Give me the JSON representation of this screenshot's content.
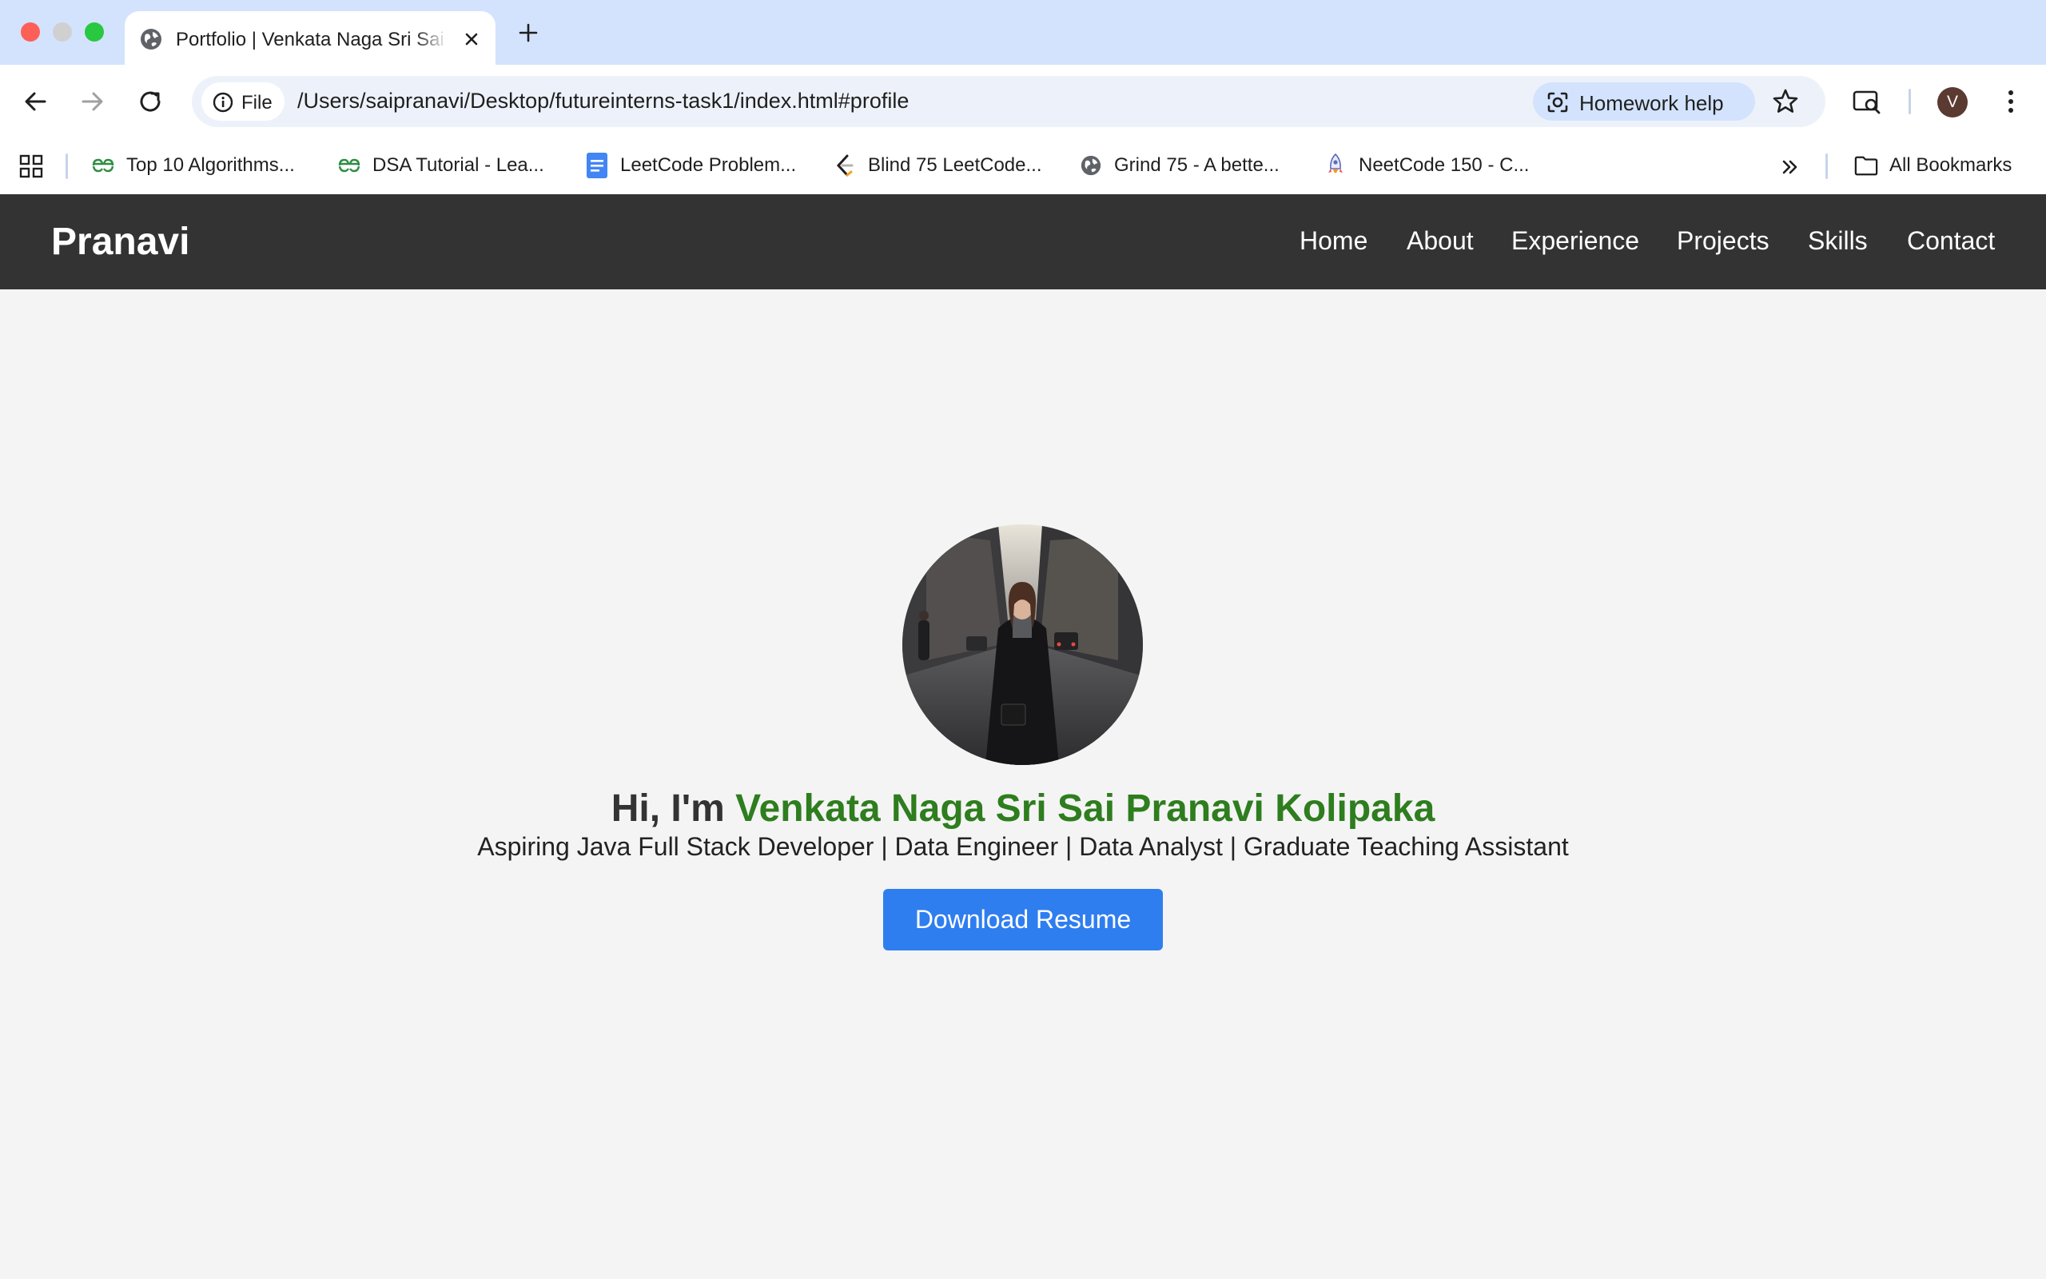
{
  "browser": {
    "tab": {
      "title": "Portfolio | Venkata Naga Sri Sai Pranavi Kolipaka"
    },
    "address_bar": {
      "scheme_chip": "File",
      "url": "/Users/saipranavi/Desktop/futureinterns-task1/index.html#profile"
    },
    "homework_help": "Homework help",
    "profile_initial": "V",
    "bookmarks": [
      {
        "label": "Top 10 Algorithms...",
        "icon": "geeksforgeeks-icon"
      },
      {
        "label": "DSA Tutorial - Lea...",
        "icon": "geeksforgeeks-icon"
      },
      {
        "label": "LeetCode Problem...",
        "icon": "google-docs-icon"
      },
      {
        "label": "Blind 75 LeetCode...",
        "icon": "leetcode-icon"
      },
      {
        "label": "Grind 75 - A bette...",
        "icon": "globe-icon"
      },
      {
        "label": "NeetCode 150 - C...",
        "icon": "rocket-icon"
      }
    ],
    "all_bookmarks": "All Bookmarks"
  },
  "site": {
    "logo": "Pranavi",
    "nav": [
      "Home",
      "About",
      "Experience",
      "Projects",
      "Skills",
      "Contact"
    ]
  },
  "hero": {
    "greeting": "Hi, I'm ",
    "name": "Venkata Naga Sri Sai Pranavi Kolipaka",
    "subtitle": "Aspiring Java Full Stack Developer | Data Engineer | Data Analyst | Graduate Teaching Assistant",
    "button": "Download Resume"
  },
  "colors": {
    "nav_background": "#333333",
    "name_accent": "#2e7d1e",
    "button": "#2f7ef0",
    "page_background": "#f4f4f4",
    "tabstrip": "#d3e3fd"
  }
}
